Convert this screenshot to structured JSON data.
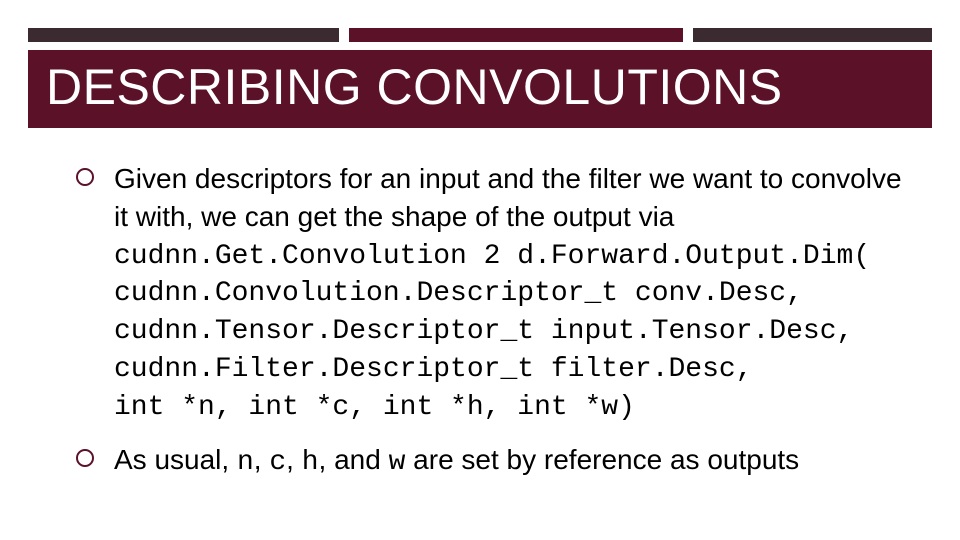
{
  "title": "DESCRIBING CONVOLUTIONS",
  "bullet1": {
    "lead": "Given descriptors for an input and the filter we want to convolve it with, we can get the shape of the output via",
    "code": "cudnn.Get.Convolution 2 d.Forward.Output.Dim(\ncudnn.Convolution.Descriptor_t conv.Desc,\ncudnn.Tensor.Descriptor_t input.Tensor.Desc,\ncudnn.Filter.Descriptor_t filter.Desc,\nint *n, int *c, int *h, int *w)"
  },
  "bullet2": {
    "pre": "As usual, ",
    "n": "n",
    "sep1": ", ",
    "c": "c",
    "sep2": ", ",
    "h": "h",
    "sep3": ", and ",
    "w": "w",
    "post": " are set by reference as outputs"
  }
}
